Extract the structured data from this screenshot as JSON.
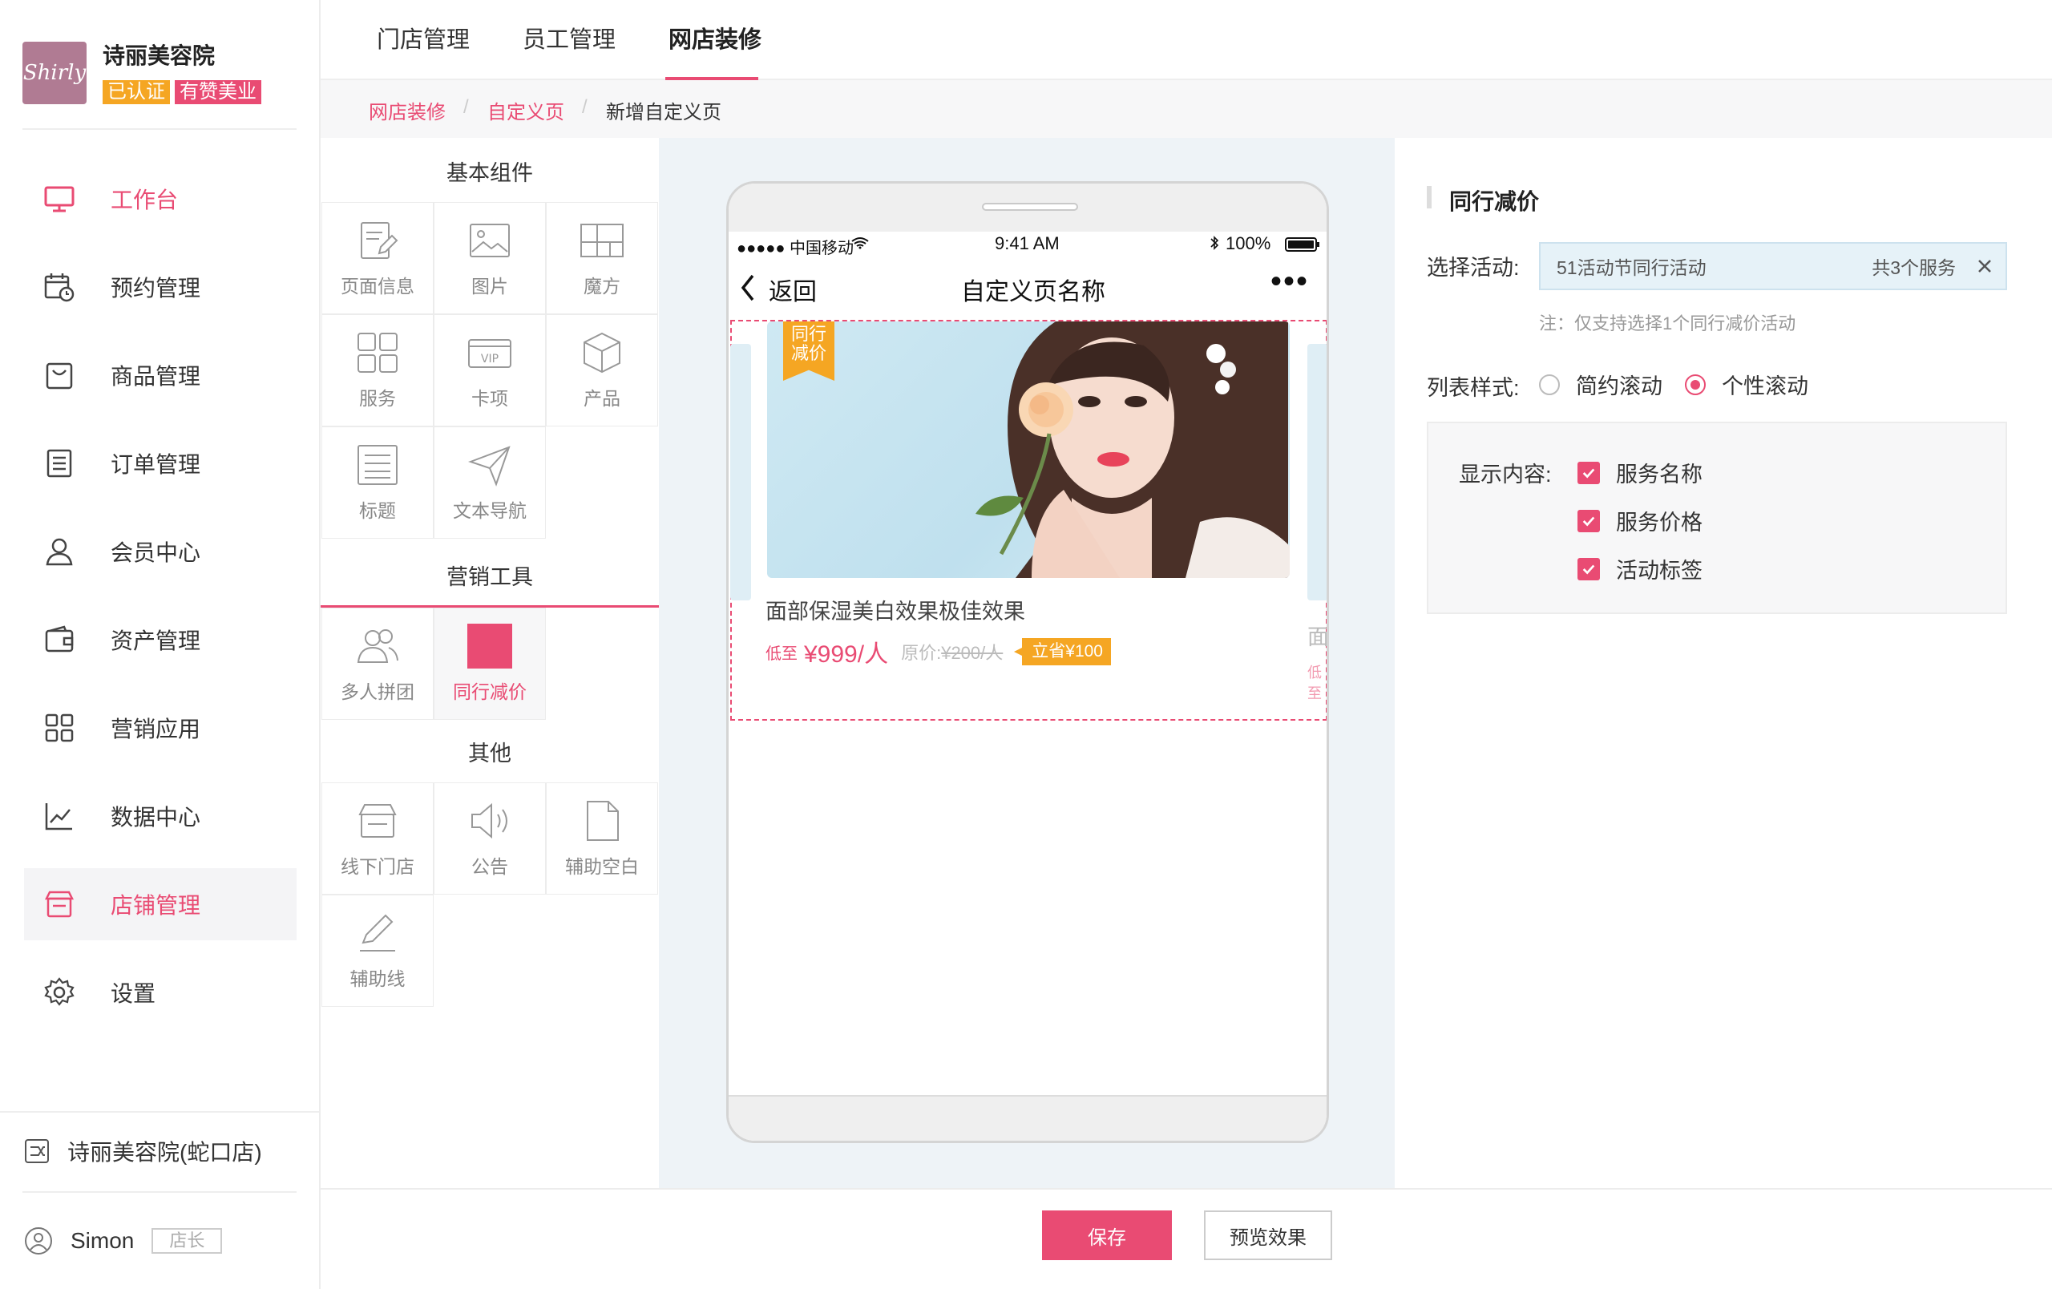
{
  "sidebar": {
    "logo_text": "Shirly",
    "shop_name": "诗丽美容院",
    "badge_verified": "已认证",
    "badge_brand": "有赞美业",
    "items": [
      {
        "label": "工作台",
        "icon": "monitor-icon"
      },
      {
        "label": "预约管理",
        "icon": "calendar-clock-icon"
      },
      {
        "label": "商品管理",
        "icon": "bag-icon"
      },
      {
        "label": "订单管理",
        "icon": "list-document-icon"
      },
      {
        "label": "会员中心",
        "icon": "user-icon"
      },
      {
        "label": "资产管理",
        "icon": "wallet-icon"
      },
      {
        "label": "营销应用",
        "icon": "grid-apps-icon"
      },
      {
        "label": "数据中心",
        "icon": "chart-line-icon"
      },
      {
        "label": "店铺管理",
        "icon": "store-icon"
      },
      {
        "label": "设置",
        "icon": "gear-icon"
      }
    ],
    "branch": "诗丽美容院(蛇口店)",
    "user_name": "Simon",
    "user_role": "店长"
  },
  "top_tabs": [
    "门店管理",
    "员工管理",
    "网店装修"
  ],
  "breadcrumb": [
    "网店装修",
    "自定义页",
    "新增自定义页"
  ],
  "components": {
    "basic_title": "基本组件",
    "basic": [
      {
        "label": "页面信息",
        "icon": "edit-page-icon"
      },
      {
        "label": "图片",
        "icon": "image-icon"
      },
      {
        "label": "魔方",
        "icon": "magic-cube-icon"
      },
      {
        "label": "服务",
        "icon": "grid-icon"
      },
      {
        "label": "卡项",
        "icon": "vip-card-icon"
      },
      {
        "label": "产品",
        "icon": "box-icon"
      },
      {
        "label": "标题",
        "icon": "title-icon"
      },
      {
        "label": "文本导航",
        "icon": "paper-plane-icon"
      }
    ],
    "marketing_title": "营销工具",
    "marketing": [
      {
        "label": "多人拼团",
        "icon": "group-icon"
      },
      {
        "label": "同行减价",
        "icon": "price-cut-icon"
      }
    ],
    "other_title": "其他",
    "other": [
      {
        "label": "线下门店",
        "icon": "shop-icon"
      },
      {
        "label": "公告",
        "icon": "speaker-icon"
      },
      {
        "label": "辅助空白",
        "icon": "blank-page-icon"
      },
      {
        "label": "辅助线",
        "icon": "pencil-icon"
      }
    ]
  },
  "phone": {
    "carrier": "●●●●● 中国移动",
    "time": "9:41 AM",
    "battery": "100%",
    "back": "返回",
    "title": "自定义页名称",
    "more": "•••",
    "ribbon": "同行减价",
    "card_title": "面部保湿美白效果极佳效果",
    "price_prefix": "低至",
    "price": "¥999/人",
    "original_label": "原价:",
    "original_price": "¥200/人",
    "save": "立省¥100",
    "peek_title": "面",
    "peek_price": "低至"
  },
  "config": {
    "title": "同行减价",
    "activity_label": "选择活动:",
    "activity_value": "51活动节同行活动",
    "activity_count": "共3个服务",
    "note": "注：仅支持选择1个同行减价活动",
    "style_label": "列表样式:",
    "style_options": [
      "简约滚动",
      "个性滚动"
    ],
    "style_selected": "个性滚动",
    "display_label": "显示内容:",
    "display_options": [
      "服务名称",
      "服务价格",
      "活动标签"
    ]
  },
  "footer": {
    "save": "保存",
    "preview": "预览效果"
  },
  "colors": {
    "accent": "#e94b73",
    "orange": "#f5a623"
  }
}
